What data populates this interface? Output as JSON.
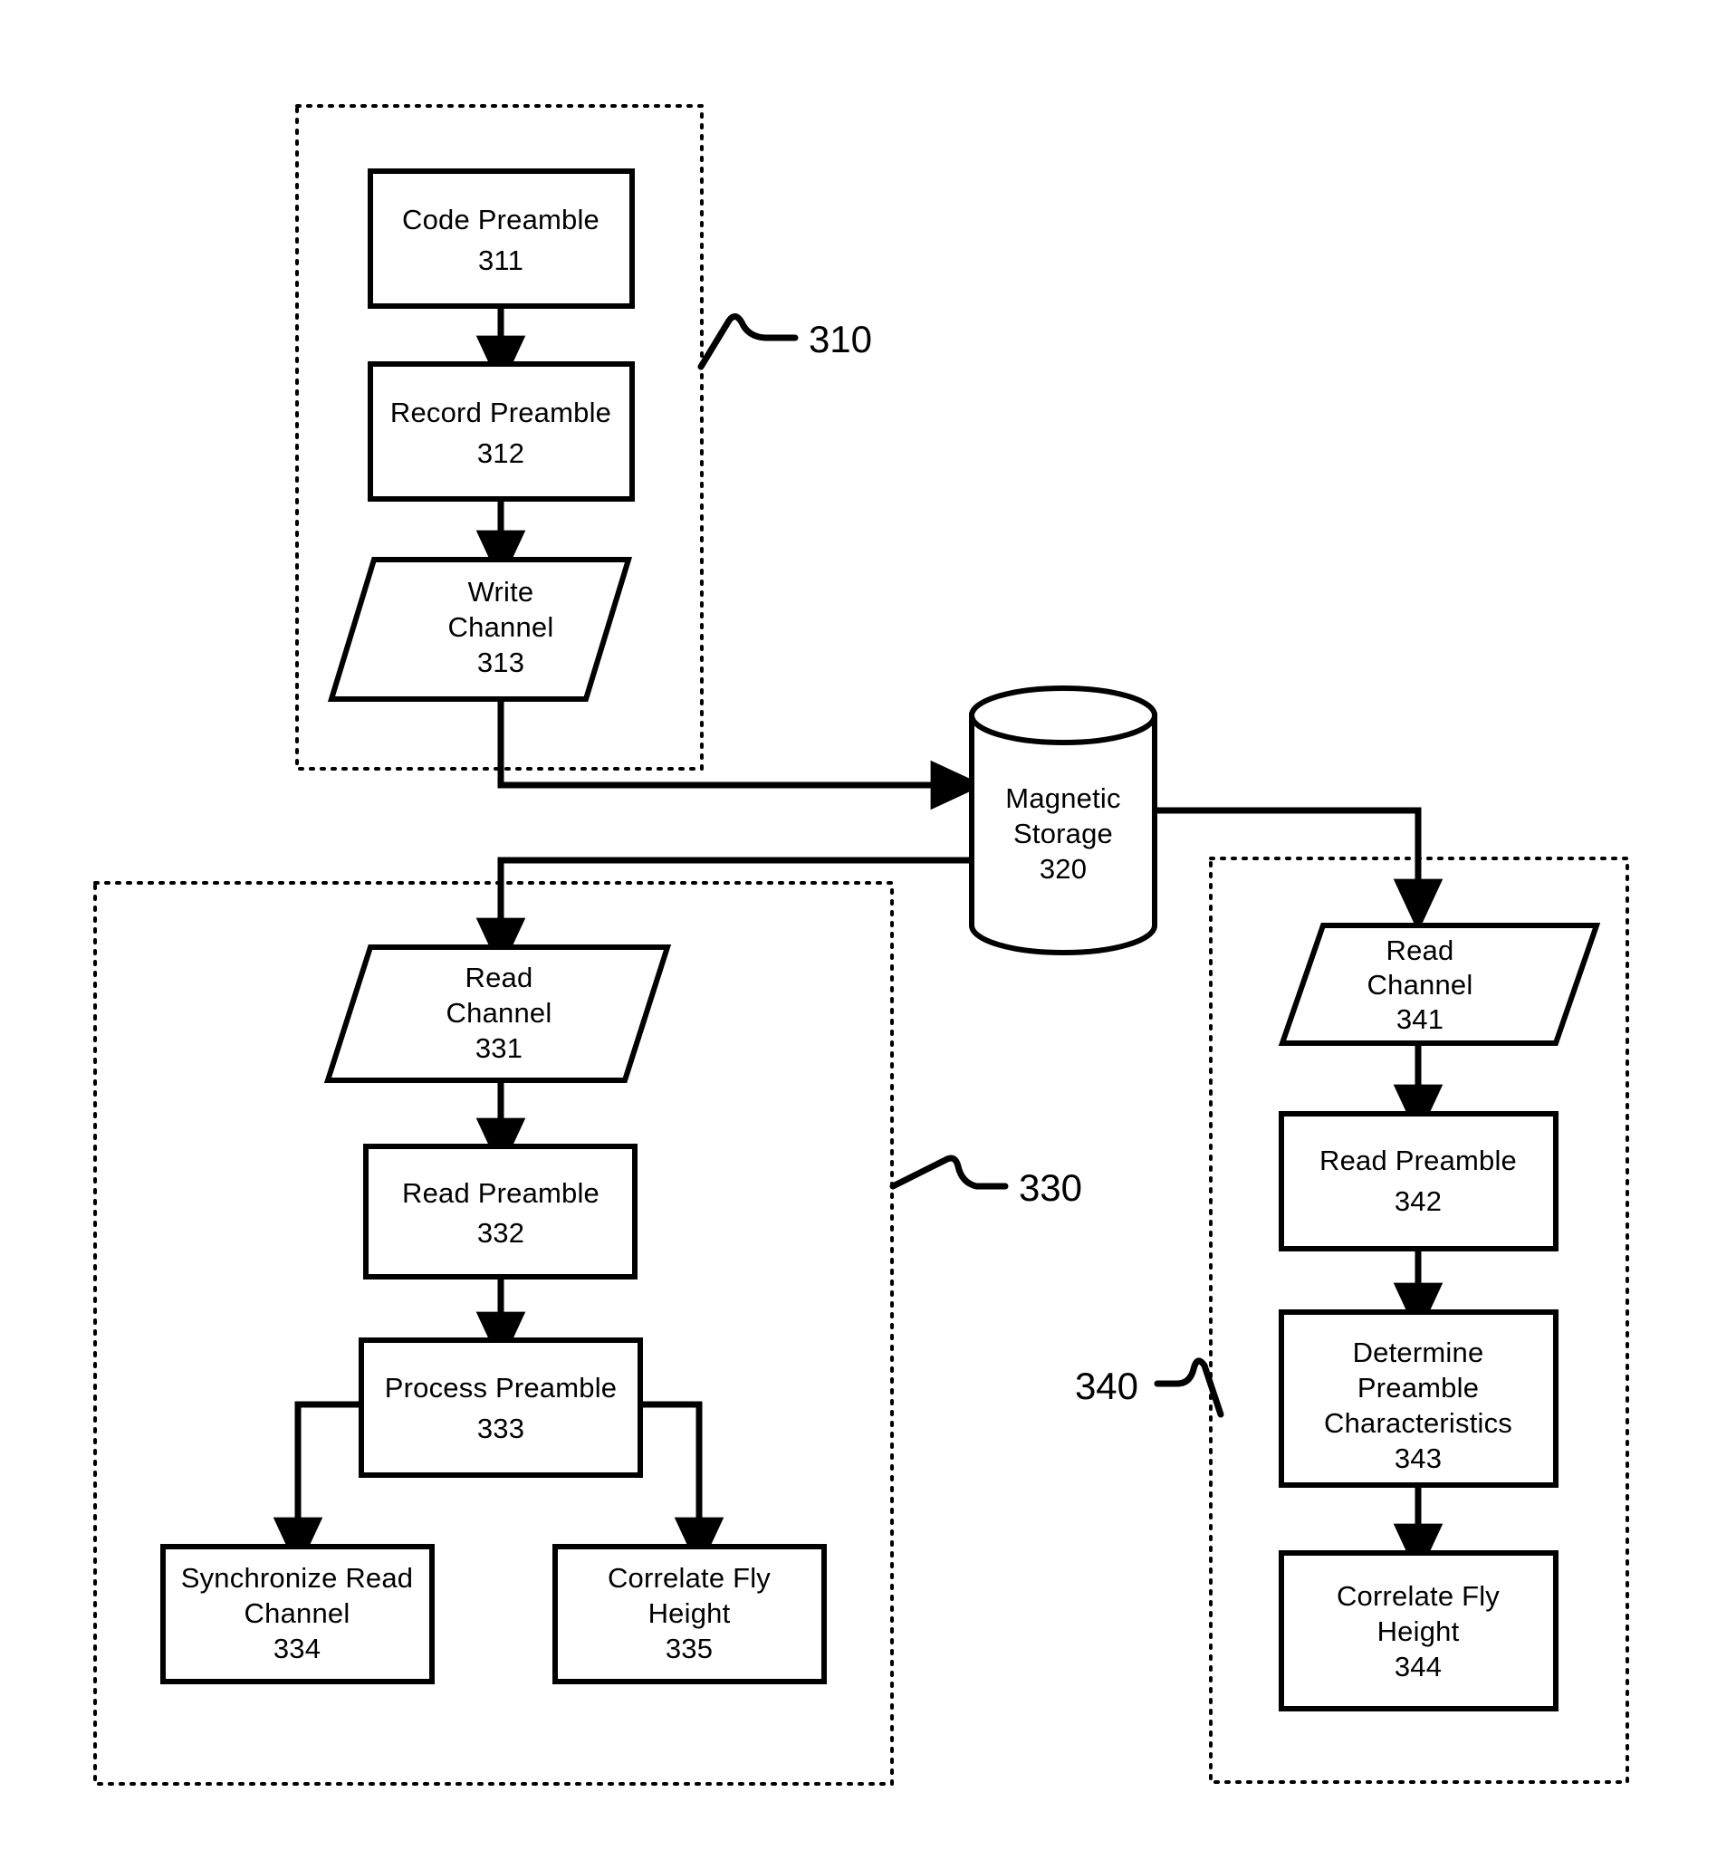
{
  "figure": {
    "type": "patent-flowchart",
    "description": "Flowchart of preamble coding, recording, reading and fly-height correlation in a magnetic storage system"
  },
  "groups": [
    {
      "id": "g310",
      "ref": "310",
      "name": "write-path-group"
    },
    {
      "id": "g330",
      "ref": "330",
      "name": "read-sync-path-group"
    },
    {
      "id": "g340",
      "ref": "340",
      "name": "fly-height-path-group"
    }
  ],
  "nodes": {
    "n311": {
      "line1": "Code Preamble",
      "line2": "",
      "line3": "",
      "ref": "311",
      "shape": "rect"
    },
    "n312": {
      "line1": "Record Preamble",
      "line2": "",
      "line3": "",
      "ref": "312",
      "shape": "rect"
    },
    "n313": {
      "line1": "Write",
      "line2": "Channel",
      "line3": "",
      "ref": "313",
      "shape": "parallelogram"
    },
    "n320": {
      "line1": "Magnetic",
      "line2": "Storage",
      "line3": "",
      "ref": "320",
      "shape": "cylinder"
    },
    "n331": {
      "line1": "Read",
      "line2": "Channel",
      "line3": "",
      "ref": "331",
      "shape": "parallelogram"
    },
    "n332": {
      "line1": "Read Preamble",
      "line2": "",
      "line3": "",
      "ref": "332",
      "shape": "rect"
    },
    "n333": {
      "line1": "Process Preamble",
      "line2": "",
      "line3": "",
      "ref": "333",
      "shape": "rect"
    },
    "n334": {
      "line1": "Synchronize Read",
      "line2": "Channel",
      "line3": "",
      "ref": "334",
      "shape": "rect"
    },
    "n335": {
      "line1": "Correlate Fly",
      "line2": "Height",
      "line3": "",
      "ref": "335",
      "shape": "rect"
    },
    "n341": {
      "line1": "Read",
      "line2": "Channel",
      "line3": "",
      "ref": "341",
      "shape": "parallelogram"
    },
    "n342": {
      "line1": "Read Preamble",
      "line2": "",
      "line3": "",
      "ref": "342",
      "shape": "rect"
    },
    "n343": {
      "line1": "Determine",
      "line2": "Preamble",
      "line3": "Characteristics",
      "ref": "343",
      "shape": "rect"
    },
    "n344": {
      "line1": "Correlate Fly",
      "line2": "Height",
      "line3": "",
      "ref": "344",
      "shape": "rect"
    }
  },
  "colors": {
    "line": "#000000",
    "fill": "#ffffff",
    "background": "#ffffff"
  }
}
